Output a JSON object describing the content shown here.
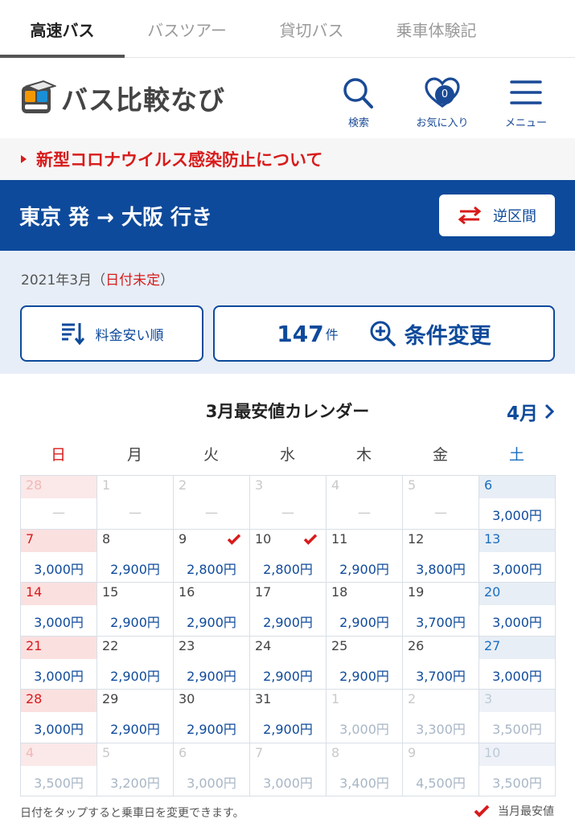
{
  "tabs": [
    {
      "label": "高速バス",
      "active": true
    },
    {
      "label": "バスツアー",
      "active": false
    },
    {
      "label": "貸切バス",
      "active": false
    },
    {
      "label": "乗車体験記",
      "active": false
    }
  ],
  "header": {
    "logo_text": "バス比較なび",
    "search_label": "検索",
    "favorites_label": "お気に入り",
    "favorites_count": "0",
    "menu_label": "メニュー"
  },
  "notice": {
    "text": "新型コロナウイルス感染防止について"
  },
  "route": {
    "title": "東京 発 → 大阪 行き",
    "swap_label": "逆区間"
  },
  "summary": {
    "date_text": "2021年3月（",
    "date_undecided": "日付未定",
    "date_close": "）",
    "sort_label": "料金安い順",
    "result_count": "147",
    "result_unit": "件",
    "condition_label": "条件変更"
  },
  "calendar": {
    "title": "3月最安値カレンダー",
    "next_month_label": "4月",
    "weekdays": [
      "日",
      "月",
      "火",
      "水",
      "木",
      "金",
      "土"
    ],
    "cells": [
      {
        "day": "28",
        "price": "—",
        "other": true
      },
      {
        "day": "1",
        "price": "—",
        "other": true
      },
      {
        "day": "2",
        "price": "—",
        "other": true
      },
      {
        "day": "3",
        "price": "—",
        "other": true
      },
      {
        "day": "4",
        "price": "—",
        "other": true
      },
      {
        "day": "5",
        "price": "—",
        "other": true
      },
      {
        "day": "6",
        "price": "3,000円",
        "other": false
      },
      {
        "day": "7",
        "price": "3,000円",
        "other": false
      },
      {
        "day": "8",
        "price": "2,900円",
        "other": false
      },
      {
        "day": "9",
        "price": "2,800円",
        "other": false,
        "lowest": true
      },
      {
        "day": "10",
        "price": "2,800円",
        "other": false,
        "lowest": true
      },
      {
        "day": "11",
        "price": "2,900円",
        "other": false
      },
      {
        "day": "12",
        "price": "3,800円",
        "other": false
      },
      {
        "day": "13",
        "price": "3,000円",
        "other": false
      },
      {
        "day": "14",
        "price": "3,000円",
        "other": false
      },
      {
        "day": "15",
        "price": "2,900円",
        "other": false
      },
      {
        "day": "16",
        "price": "2,900円",
        "other": false
      },
      {
        "day": "17",
        "price": "2,900円",
        "other": false
      },
      {
        "day": "18",
        "price": "2,900円",
        "other": false
      },
      {
        "day": "19",
        "price": "3,700円",
        "other": false
      },
      {
        "day": "20",
        "price": "3,000円",
        "other": false
      },
      {
        "day": "21",
        "price": "3,000円",
        "other": false
      },
      {
        "day": "22",
        "price": "2,900円",
        "other": false
      },
      {
        "day": "23",
        "price": "2,900円",
        "other": false
      },
      {
        "day": "24",
        "price": "2,900円",
        "other": false
      },
      {
        "day": "25",
        "price": "2,900円",
        "other": false
      },
      {
        "day": "26",
        "price": "3,700円",
        "other": false
      },
      {
        "day": "27",
        "price": "3,000円",
        "other": false
      },
      {
        "day": "28",
        "price": "3,000円",
        "other": false
      },
      {
        "day": "29",
        "price": "2,900円",
        "other": false
      },
      {
        "day": "30",
        "price": "2,900円",
        "other": false
      },
      {
        "day": "31",
        "price": "2,900円",
        "other": false
      },
      {
        "day": "1",
        "price": "3,000円",
        "other": true
      },
      {
        "day": "2",
        "price": "3,300円",
        "other": true
      },
      {
        "day": "3",
        "price": "3,500円",
        "other": true
      },
      {
        "day": "4",
        "price": "3,500円",
        "other": true
      },
      {
        "day": "5",
        "price": "3,200円",
        "other": true
      },
      {
        "day": "6",
        "price": "3,000円",
        "other": true
      },
      {
        "day": "7",
        "price": "3,000円",
        "other": true
      },
      {
        "day": "8",
        "price": "3,400円",
        "other": true
      },
      {
        "day": "9",
        "price": "4,500円",
        "other": true
      },
      {
        "day": "10",
        "price": "3,500円",
        "other": true
      }
    ],
    "hint": "日付をタップすると乗車日を変更できます。",
    "legend_label": "当月最安値"
  },
  "colors": {
    "brand_blue": "#0e4a9b",
    "alert_red": "#d81b1b",
    "summary_bg": "#e7eef7"
  }
}
